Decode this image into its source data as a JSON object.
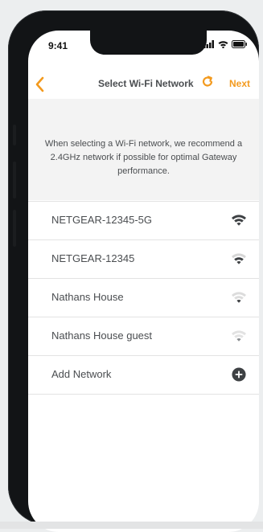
{
  "status": {
    "time": "9:41"
  },
  "nav": {
    "title": "Select Wi-Fi Network",
    "next_label": "Next",
    "back_icon": "chevron-left-icon",
    "refresh_icon": "refresh-icon",
    "accent_color": "#f39a1e"
  },
  "info": {
    "text": "When selecting a Wi-Fi network, we recommend a 2.4GHz network if possible for optimal Gateway performance."
  },
  "networks": [
    {
      "label": "NETGEAR-12345-5G",
      "icon": "wifi-strong-icon",
      "signal": 4
    },
    {
      "label": "NETGEAR-12345",
      "icon": "wifi-good-icon",
      "signal": 3
    },
    {
      "label": "Nathans House",
      "icon": "wifi-medium-icon",
      "signal": 2
    },
    {
      "label": "Nathans House guest",
      "icon": "wifi-weak-icon",
      "signal": 1
    }
  ],
  "add_network": {
    "label": "Add Network",
    "icon": "plus-circle-icon"
  }
}
